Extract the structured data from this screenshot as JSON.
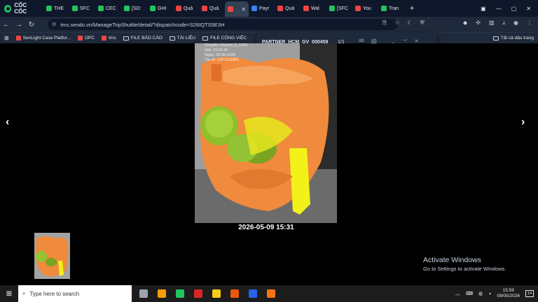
{
  "browser": {
    "brand": "CỐC CỐC",
    "tabs": [
      {
        "label": "THE",
        "color": "#22c55e"
      },
      {
        "label": "SFC",
        "color": "#22c55e"
      },
      {
        "label": "CEC",
        "color": "#22c55e"
      },
      {
        "label": "[SD:",
        "color": "#22c55e"
      },
      {
        "label": "GHI",
        "color": "#22c55e"
      },
      {
        "label": "Quả",
        "color": "#ef4444"
      },
      {
        "label": "Quả",
        "color": "#ef4444"
      },
      {
        "label": "",
        "color": "#ef4444",
        "active": true
      },
      {
        "label": "Payr",
        "color": "#3b82f6"
      },
      {
        "label": "Quả",
        "color": "#ef4444"
      },
      {
        "label": "Wal",
        "color": "#ef4444"
      },
      {
        "label": "[SFC",
        "color": "#22c55e"
      },
      {
        "label": "You",
        "color": "#ef4444"
      },
      {
        "label": "Tran",
        "color": "#22c55e"
      }
    ],
    "new_tab": "+",
    "url": "tms.sendo.vn/ManageTripShuttle/detail/?dispatchcode=S26IQTS5E3H",
    "bookmarks": [
      {
        "label": "SenLight Case Platfor...",
        "type": "site",
        "color": "#ef4444"
      },
      {
        "label": "OPC",
        "type": "site",
        "color": "#ef4444"
      },
      {
        "label": "tms",
        "type": "site",
        "color": "#ef4444"
      },
      {
        "label": "FILE BÁO CÁO",
        "type": "folder"
      },
      {
        "label": "TÀI LIỆU",
        "type": "folder"
      },
      {
        "label": "FILE CÔNG VIỆC",
        "type": "folder"
      }
    ],
    "all_bookmarks": "Tất cả dấu trang"
  },
  "find": {
    "query": "PARTNER_HCM_GV_000459",
    "count": "1/1",
    "match_case": "ab",
    "whole_word": "ab"
  },
  "viewer": {
    "prev": "‹",
    "next": "›",
    "caption": "2026-05-09 15:31",
    "photo_overlay": [
      "Chuyến: chuyen_0_1234",
      "Giờ: 15:31:41",
      "Ngày: 09-05-2026",
      "Tài xế: 0397818989"
    ]
  },
  "watermark": {
    "title": "Activate Windows",
    "subtitle": "Go to Settings to activate Windows."
  },
  "taskbar": {
    "search_placeholder": "Type here to search",
    "time": "15:59",
    "date": "09/05/2026",
    "notifications": "14",
    "apps": [
      {
        "name": "task-view",
        "color": "#9ca3af"
      },
      {
        "name": "file-explorer",
        "color": "#f59e0b"
      },
      {
        "name": "coc-coc",
        "color": "#22c55e"
      },
      {
        "name": "wps-office",
        "color": "#dc2626"
      },
      {
        "name": "sticky-notes",
        "color": "#facc15"
      },
      {
        "name": "chrome",
        "color": "#ea580c"
      },
      {
        "name": "zalo",
        "color": "#2563eb"
      },
      {
        "name": "app-orange",
        "color": "#f97316"
      }
    ]
  }
}
